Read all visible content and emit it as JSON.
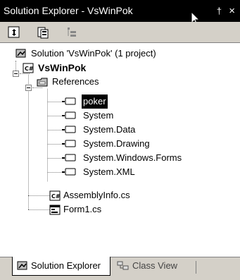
{
  "window": {
    "title": "Solution Explorer - VsWinPok",
    "pin_glyph": "†",
    "close_glyph": "×"
  },
  "toolbar": {
    "buttons": [
      {
        "icon": "refresh-icon"
      },
      {
        "icon": "properties-icon"
      },
      {
        "icon": "show-all-files-icon"
      }
    ]
  },
  "tree": {
    "solution_label": "Solution 'VsWinPok' (1 project)",
    "project_label": "VsWinPok",
    "references_label": "References",
    "references": [
      "poker",
      "System",
      "System.Data",
      "System.Drawing",
      "System.Windows.Forms",
      "System.XML"
    ],
    "selected_reference": "poker",
    "files": [
      "AssemblyInfo.cs",
      "Form1.cs"
    ]
  },
  "tabs": {
    "active": "Solution Explorer",
    "inactive": "Class View"
  },
  "colors": {
    "title_bg": "#000000",
    "panel_bg": "#d4d0c8",
    "selection_bg": "#000000"
  }
}
